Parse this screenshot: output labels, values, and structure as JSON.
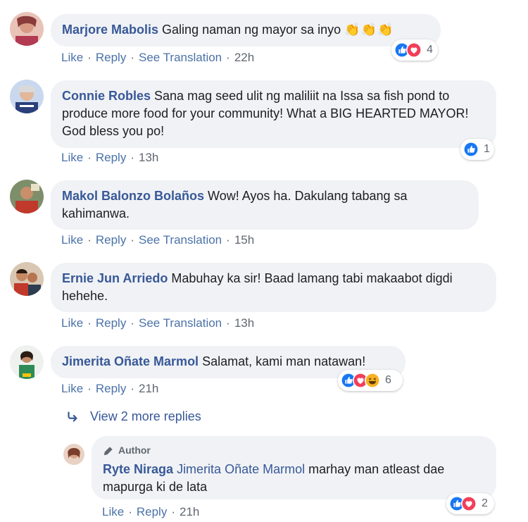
{
  "actions": {
    "like": "Like",
    "reply": "Reply",
    "see_translation": "See Translation"
  },
  "comments": [
    {
      "name": "Marjore Mabolis",
      "text": "Galing naman ng mayor sa inyo",
      "emoji": "👏👏👏",
      "time": "22h",
      "reaction_count": "4"
    },
    {
      "name": "Connie Robles",
      "text": "Sana mag seed ulit ng maliliit na Issa sa fish pond to produce more food for your community! What a BIG HEARTED MAYOR! God bless you po!",
      "time": "13h",
      "reaction_count": "1"
    },
    {
      "name": "Makol Balonzo Bolaños",
      "text": "Wow! Ayos ha. Dakulang tabang sa kahimanwa.",
      "time": "15h"
    },
    {
      "name": "Ernie Jun Arriedo",
      "text": "Mabuhay ka sir! Baad lamang tabi makaabot digdi hehehe.",
      "time": "13h"
    },
    {
      "name": "Jimerita Oñate Marmol",
      "text": "Salamat, kami man natawan!",
      "time": "21h",
      "reaction_count": "6"
    }
  ],
  "view_more_replies": "View 2 more replies",
  "reply": {
    "badge": "Author",
    "name": "Ryte Niraga",
    "mention": "Jimerita Oñate Marmol",
    "text": "marhay man atleast dae mapurga ki de lata",
    "time": "21h",
    "reaction_count": "2"
  },
  "colors": {
    "link": "#385898",
    "bubble": "#f0f2f5",
    "like_blue": "#1877f2",
    "love_red": "#f33e58",
    "haha_yellow": "#f7b125"
  }
}
